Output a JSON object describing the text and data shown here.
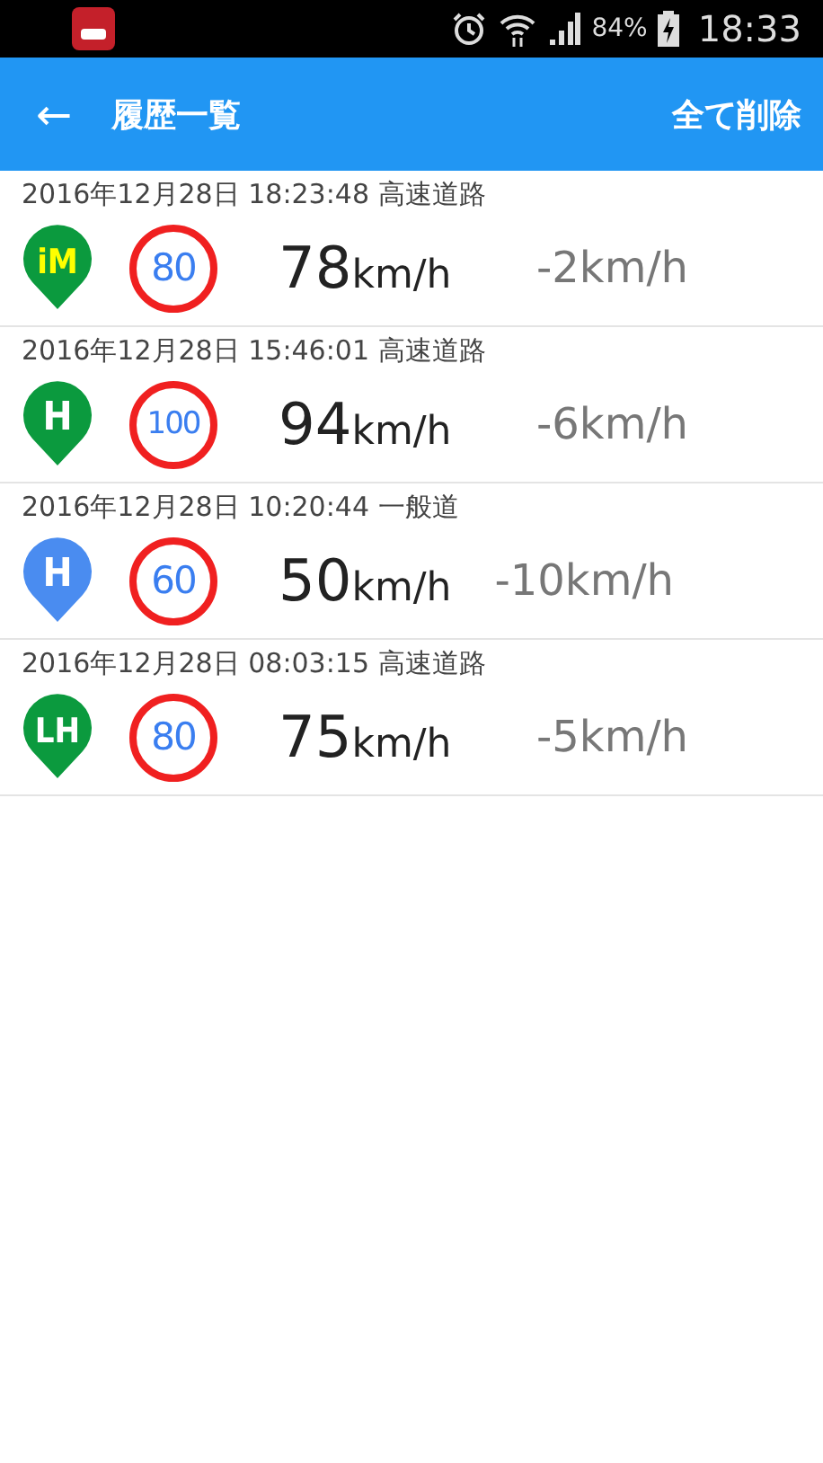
{
  "status_bar": {
    "battery_percent": "84%",
    "time": "18:33"
  },
  "app_bar": {
    "back": "←",
    "title": "履歴一覧",
    "action": "全て削除"
  },
  "records": [
    {
      "datetime": "2016年12月28日 18:23:48 高速道路",
      "marker": {
        "label": "iM",
        "color": "#0b9a3e",
        "kind": "accent"
      },
      "limit": "80",
      "speed": "78",
      "speed_unit": "km/h",
      "difference": "-2km/h"
    },
    {
      "datetime": "2016年12月28日 15:46:01 高速道路",
      "marker": {
        "label": "H",
        "color": "#0b9a3e",
        "kind": "plain"
      },
      "limit": "100",
      "speed": "94",
      "speed_unit": "km/h",
      "difference": "-6km/h"
    },
    {
      "datetime": "2016年12月28日 10:20:44 一般道",
      "marker": {
        "label": "H",
        "color": "#4a8cf0",
        "kind": "plain"
      },
      "limit": "60",
      "speed": "50",
      "speed_unit": "km/h",
      "difference": "-10km/h"
    },
    {
      "datetime": "2016年12月28日 08:03:15 高速道路",
      "marker": {
        "label": "LH",
        "color": "#0b9a3e",
        "kind": "plain"
      },
      "limit": "80",
      "speed": "75",
      "speed_unit": "km/h",
      "difference": "-5km/h"
    }
  ]
}
